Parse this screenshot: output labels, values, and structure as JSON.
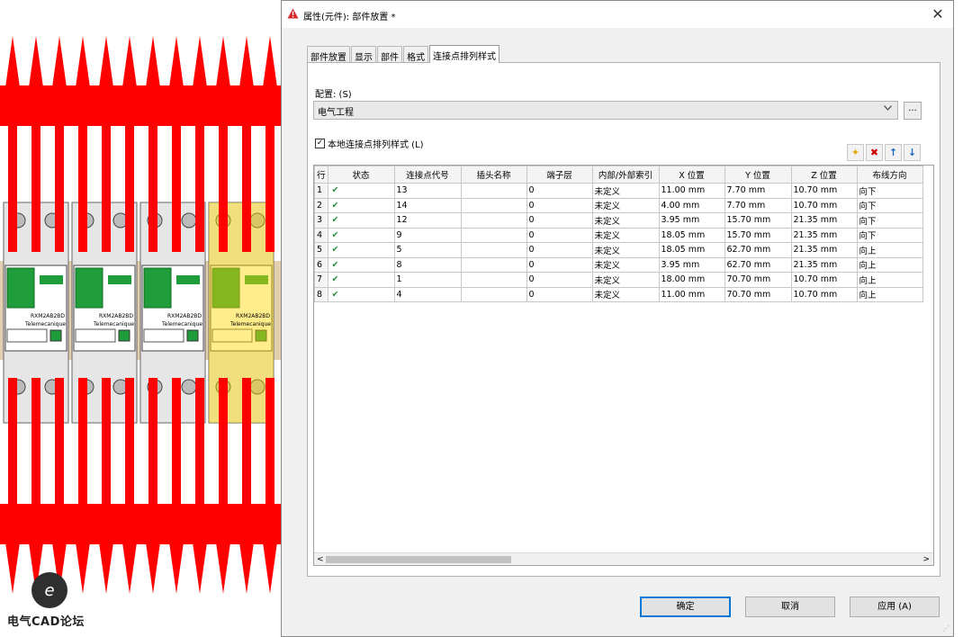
{
  "background": {
    "watermark_text": "电气CAD论坛",
    "logo_letter": "e",
    "device_labels": [
      "RXM2AB2BD",
      "RXM2AB2BD",
      "RXM2AB2BD",
      "RXM2AB2BD"
    ],
    "device_brand": "Telemecanique",
    "arrow_color": "#ff0000",
    "highlight_color": "#ffd700"
  },
  "dialog": {
    "title": "属性(元件): 部件放置 *",
    "close_label": "✕",
    "tabs": [
      "部件放置",
      "显示",
      "部件",
      "格式",
      "连接点排列样式"
    ],
    "active_tab": 4,
    "config": {
      "label": "配置: (S)",
      "value": "电气工程",
      "more_label": "..."
    },
    "local_style": {
      "label": "本地连接点排列样式 (L)",
      "checked": "✓"
    },
    "toolbar": {
      "add": "✦",
      "delete": "✖",
      "up": "↑",
      "down": "↓"
    },
    "table": {
      "headers": [
        "行",
        "状态",
        "连接点代号",
        "插头名称",
        "端子层",
        "内部/外部索引",
        "X 位置",
        "Y 位置",
        "Z 位置",
        "布线方向"
      ],
      "rows": [
        [
          "1",
          "✔",
          "13",
          "",
          "0",
          "未定义",
          "11.00 mm",
          "7.70 mm",
          "10.70 mm",
          "向下"
        ],
        [
          "2",
          "✔",
          "14",
          "",
          "0",
          "未定义",
          "4.00 mm",
          "7.70 mm",
          "10.70 mm",
          "向下"
        ],
        [
          "3",
          "✔",
          "12",
          "",
          "0",
          "未定义",
          "3.95 mm",
          "15.70 mm",
          "21.35 mm",
          "向下"
        ],
        [
          "4",
          "✔",
          "9",
          "",
          "0",
          "未定义",
          "18.05 mm",
          "15.70 mm",
          "21.35 mm",
          "向下"
        ],
        [
          "5",
          "✔",
          "5",
          "",
          "0",
          "未定义",
          "18.05 mm",
          "62.70 mm",
          "21.35 mm",
          "向上"
        ],
        [
          "6",
          "✔",
          "8",
          "",
          "0",
          "未定义",
          "3.95 mm",
          "62.70 mm",
          "21.35 mm",
          "向上"
        ],
        [
          "7",
          "✔",
          "1",
          "",
          "0",
          "未定义",
          "18.00 mm",
          "70.70 mm",
          "10.70 mm",
          "向上"
        ],
        [
          "8",
          "✔",
          "4",
          "",
          "0",
          "未定义",
          "11.00 mm",
          "70.70 mm",
          "10.70 mm",
          "向上"
        ]
      ]
    },
    "scroll": {
      "left": "<",
      "right": ">"
    },
    "buttons": {
      "ok": "确定",
      "cancel": "取消",
      "apply": "应用 (A)"
    }
  }
}
